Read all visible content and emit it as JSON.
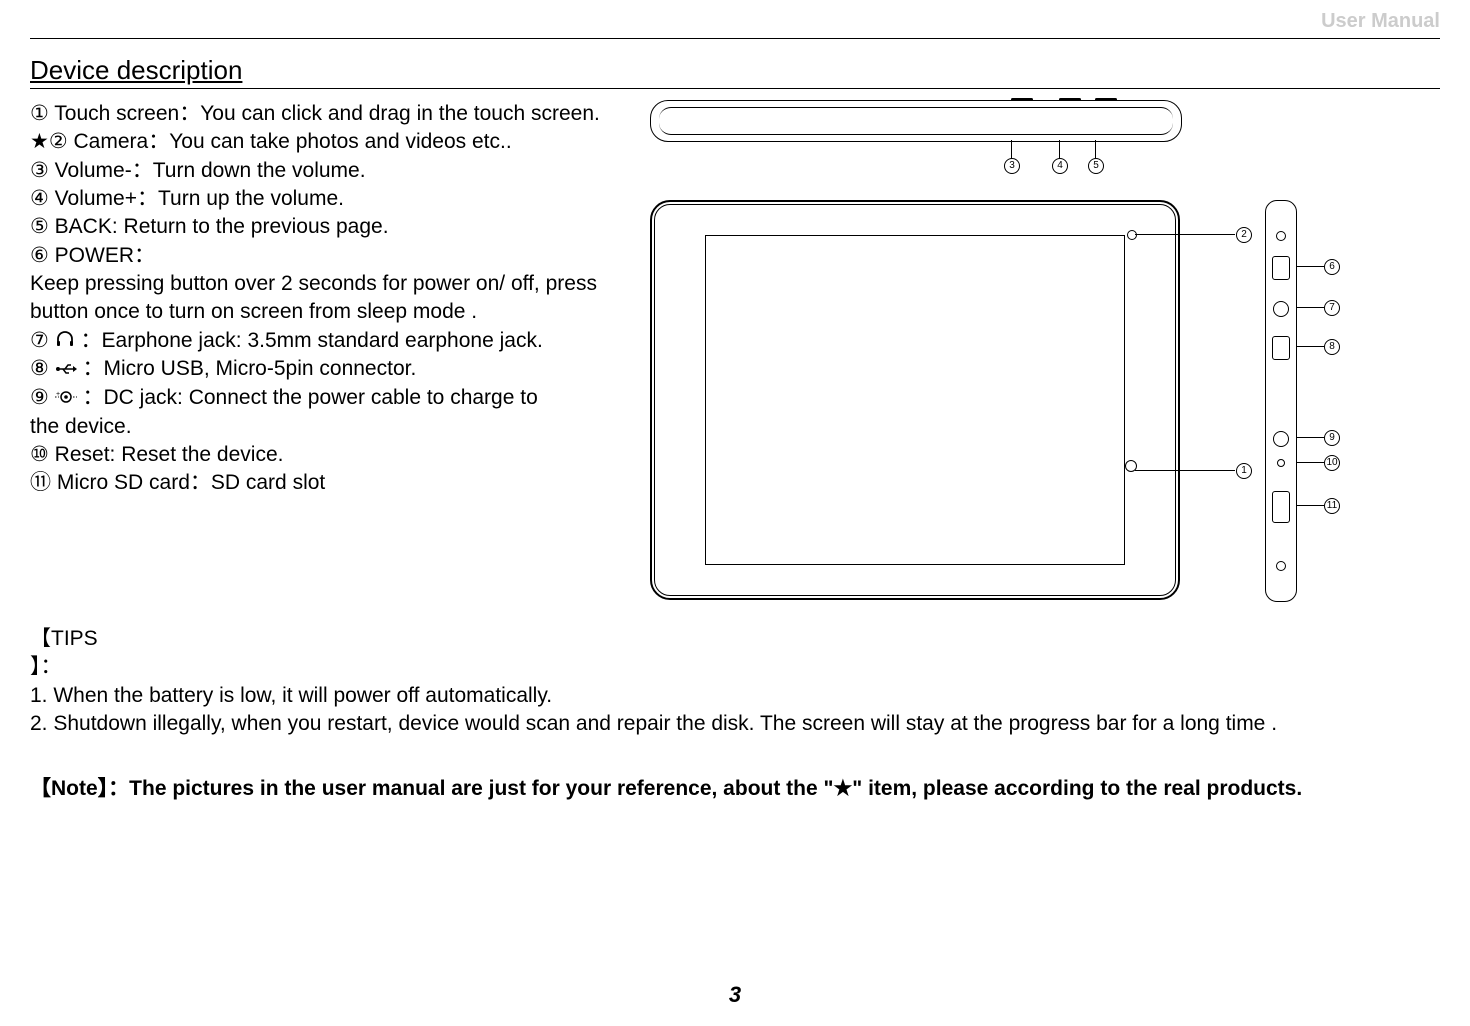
{
  "header": {
    "label": "User Manual"
  },
  "section": {
    "title": "Device description"
  },
  "items": {
    "n1": "①",
    "t1_label": "Touch screen：",
    "t1_desc": "You can click and drag in the touch screen.",
    "star": "★",
    "n2": "②",
    "t2_label": "Camera：",
    "t2_desc": "You can take photos and videos etc..",
    "n3": "③",
    "t3_label": "Volume-：",
    "t3_desc": "Turn down the volume.",
    "n4": "④",
    "t4_label": "Volume+：",
    "t4_desc": "Turn up the volume.",
    "n5": "⑤",
    "t5_label": "BACK: ",
    "t5_desc": "Return to the previous page.",
    "n6": "⑥",
    "t6_label": "POWER：",
    "t6_desc": "Keep pressing button over 2 seconds for power on/ off, press button once to turn on screen from sleep mode .",
    "n7": "⑦",
    "t7_label": "：Earphone jack: ",
    "t7_desc": "3.5mm standard earphone jack.",
    "n8": "⑧",
    "t8_label": "：Micro USB, ",
    "t8_desc": "Micro-5pin connector.",
    "n9": "⑨",
    "t9_label": "：DC jack: ",
    "t9_desc": "Connect the power cable to charge to",
    "t9_desc2": "the device.",
    "n10": "⑩",
    "t10_label": "Reset: ",
    "t10_desc": "Reset the device.",
    "n11": "⑪",
    "t11_label": "Micro SD card：",
    "t11_desc": "SD card slot"
  },
  "tips": {
    "label": "【TIPS 】：",
    "line1": "1. When the battery is low, it will power off automatically.",
    "line2": "2. Shutdown illegally, when you restart, device would scan and repair the disk. The screen will stay at the progress bar for a long time ."
  },
  "note": {
    "label": "【Note】：",
    "text": "The pictures in the user manual are just for your reference, about the \"★\" item, please according to the real products."
  },
  "page": {
    "number": "3"
  },
  "diagram_labels": {
    "c1": "1",
    "c2": "2",
    "c3": "3",
    "c4": "4",
    "c5": "5",
    "c6": "6",
    "c7": "7",
    "c8": "8",
    "c9": "9",
    "c10": "10",
    "c11": "11"
  }
}
